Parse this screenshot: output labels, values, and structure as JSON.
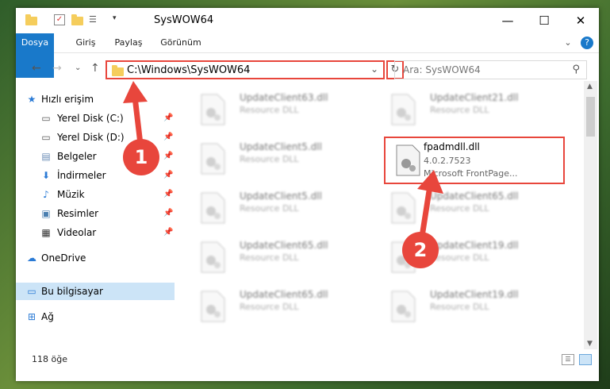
{
  "window": {
    "title": "SysWOW64",
    "minimize": "—",
    "maximize": "☐",
    "close": "✕"
  },
  "ribbon": {
    "tabs": [
      "Dosya",
      "Giriş",
      "Paylaş",
      "Görünüm"
    ],
    "expand": "⌄",
    "help": "?"
  },
  "nav": {
    "back": "←",
    "forward": "→",
    "recent": "⌄",
    "up": "↑",
    "path": "C:\\Windows\\SysWOW64",
    "dropdown": "⌄",
    "refresh": "↻",
    "search_placeholder": "Ara: SysWOW64"
  },
  "sidebar": {
    "items": [
      {
        "label": "Hızlı erişim",
        "icon": "star-icon"
      },
      {
        "label": "Yerel Disk (C:)",
        "icon": "drive-icon",
        "pinned": true
      },
      {
        "label": "Yerel Disk (D:)",
        "icon": "drive-icon",
        "pinned": true
      },
      {
        "label": "Belgeler",
        "icon": "documents-icon",
        "pinned": true
      },
      {
        "label": "İndirmeler",
        "icon": "download-icon",
        "pinned": true
      },
      {
        "label": "Müzik",
        "icon": "music-icon",
        "pinned": true
      },
      {
        "label": "Resimler",
        "icon": "pictures-icon",
        "pinned": true
      },
      {
        "label": "Videolar",
        "icon": "videos-icon",
        "pinned": true
      },
      {
        "label": "OneDrive",
        "icon": "cloud-icon"
      },
      {
        "label": "Bu bilgisayar",
        "icon": "computer-icon",
        "selected": true
      },
      {
        "label": "Ağ",
        "icon": "network-icon"
      }
    ]
  },
  "files": [
    {
      "name": "UpdateClient63.dll",
      "desc": "Resource DLL"
    },
    {
      "name": "UpdateClient21.dll",
      "desc": "Resource DLL"
    },
    {
      "name": "UpdateClient5.dll",
      "desc": "Resource DLL"
    },
    {
      "name": "fpadmdll.dll",
      "version": "4.0.2.7523",
      "company": "Microsoft FrontPage..."
    },
    {
      "name": "UpdateClient5.dll",
      "desc": "Resource DLL"
    },
    {
      "name": "UpdateClient65.dll",
      "desc": "Resource DLL"
    },
    {
      "name": "UpdateClient65.dll",
      "desc": "Resource DLL"
    },
    {
      "name": "UpdateClient19.dll",
      "desc": "Resource DLL"
    },
    {
      "name": "UpdateClient65.dll",
      "desc": "Resource DLL"
    },
    {
      "name": "UpdateClient19.dll",
      "desc": "Resource DLL"
    }
  ],
  "status": {
    "count": "118 öğe"
  },
  "callouts": [
    "1",
    "2"
  ],
  "colors": {
    "accent": "#1979ca",
    "highlight": "#e8463c",
    "selected": "#cce4f7"
  }
}
